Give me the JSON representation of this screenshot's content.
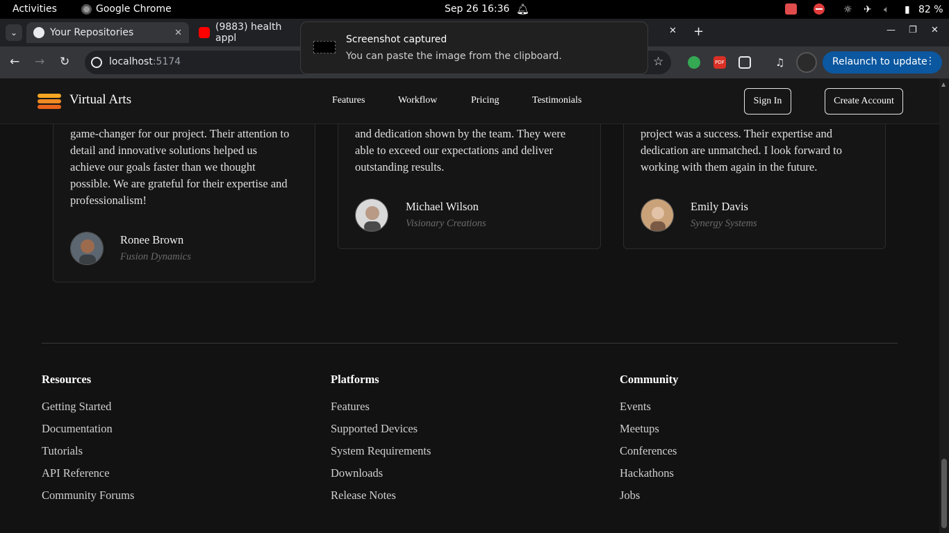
{
  "system_bar": {
    "activities": "Activities",
    "app_name": "Google Chrome",
    "datetime": "Sep 26  16:36",
    "battery": "82 %"
  },
  "browser": {
    "tabs": [
      {
        "title": "Your Repositories",
        "favicon": "github-icon"
      },
      {
        "title": "(9883) health appl",
        "favicon": "youtube-icon"
      }
    ],
    "url_host": "localhost",
    "url_port": ":5174",
    "relaunch_label": "Relaunch to update"
  },
  "notification": {
    "title": "Screenshot captured",
    "body": "You can paste the image from the clipboard."
  },
  "site": {
    "brand": "Virtual Arts",
    "nav": [
      "Features",
      "Workflow",
      "Pricing",
      "Testimonials"
    ],
    "sign_in": "Sign In",
    "create_account": "Create Account",
    "testimonials": [
      {
        "lines": [
          "game-changer for our project. Their attention to",
          "detail and innovative solutions helped us",
          "achieve our goals faster than we thought",
          "possible. We are grateful for their expertise and",
          "professionalism!"
        ],
        "name": "Ronee Brown",
        "company": "Fusion Dynamics"
      },
      {
        "lines": [
          "and dedication shown by the team. They were",
          "able to exceed our expectations and deliver",
          "outstanding results."
        ],
        "name": "Michael Wilson",
        "company": "Visionary Creations"
      },
      {
        "lines": [
          "project was a success. Their expertise and",
          "dedication are unmatched. I look forward to",
          "working with them again in the future."
        ],
        "name": "Emily Davis",
        "company": "Synergy Systems"
      }
    ],
    "footer": [
      {
        "heading": "Resources",
        "links": [
          "Getting Started",
          "Documentation",
          "Tutorials",
          "API Reference",
          "Community Forums"
        ]
      },
      {
        "heading": "Platforms",
        "links": [
          "Features",
          "Supported Devices",
          "System Requirements",
          "Downloads",
          "Release Notes"
        ]
      },
      {
        "heading": "Community",
        "links": [
          "Events",
          "Meetups",
          "Conferences",
          "Hackathons",
          "Jobs"
        ]
      }
    ]
  },
  "colors": {
    "page_bg": "#121212",
    "brand_orange": "#f08a24",
    "relaunch_blue": "#0b57a0"
  }
}
